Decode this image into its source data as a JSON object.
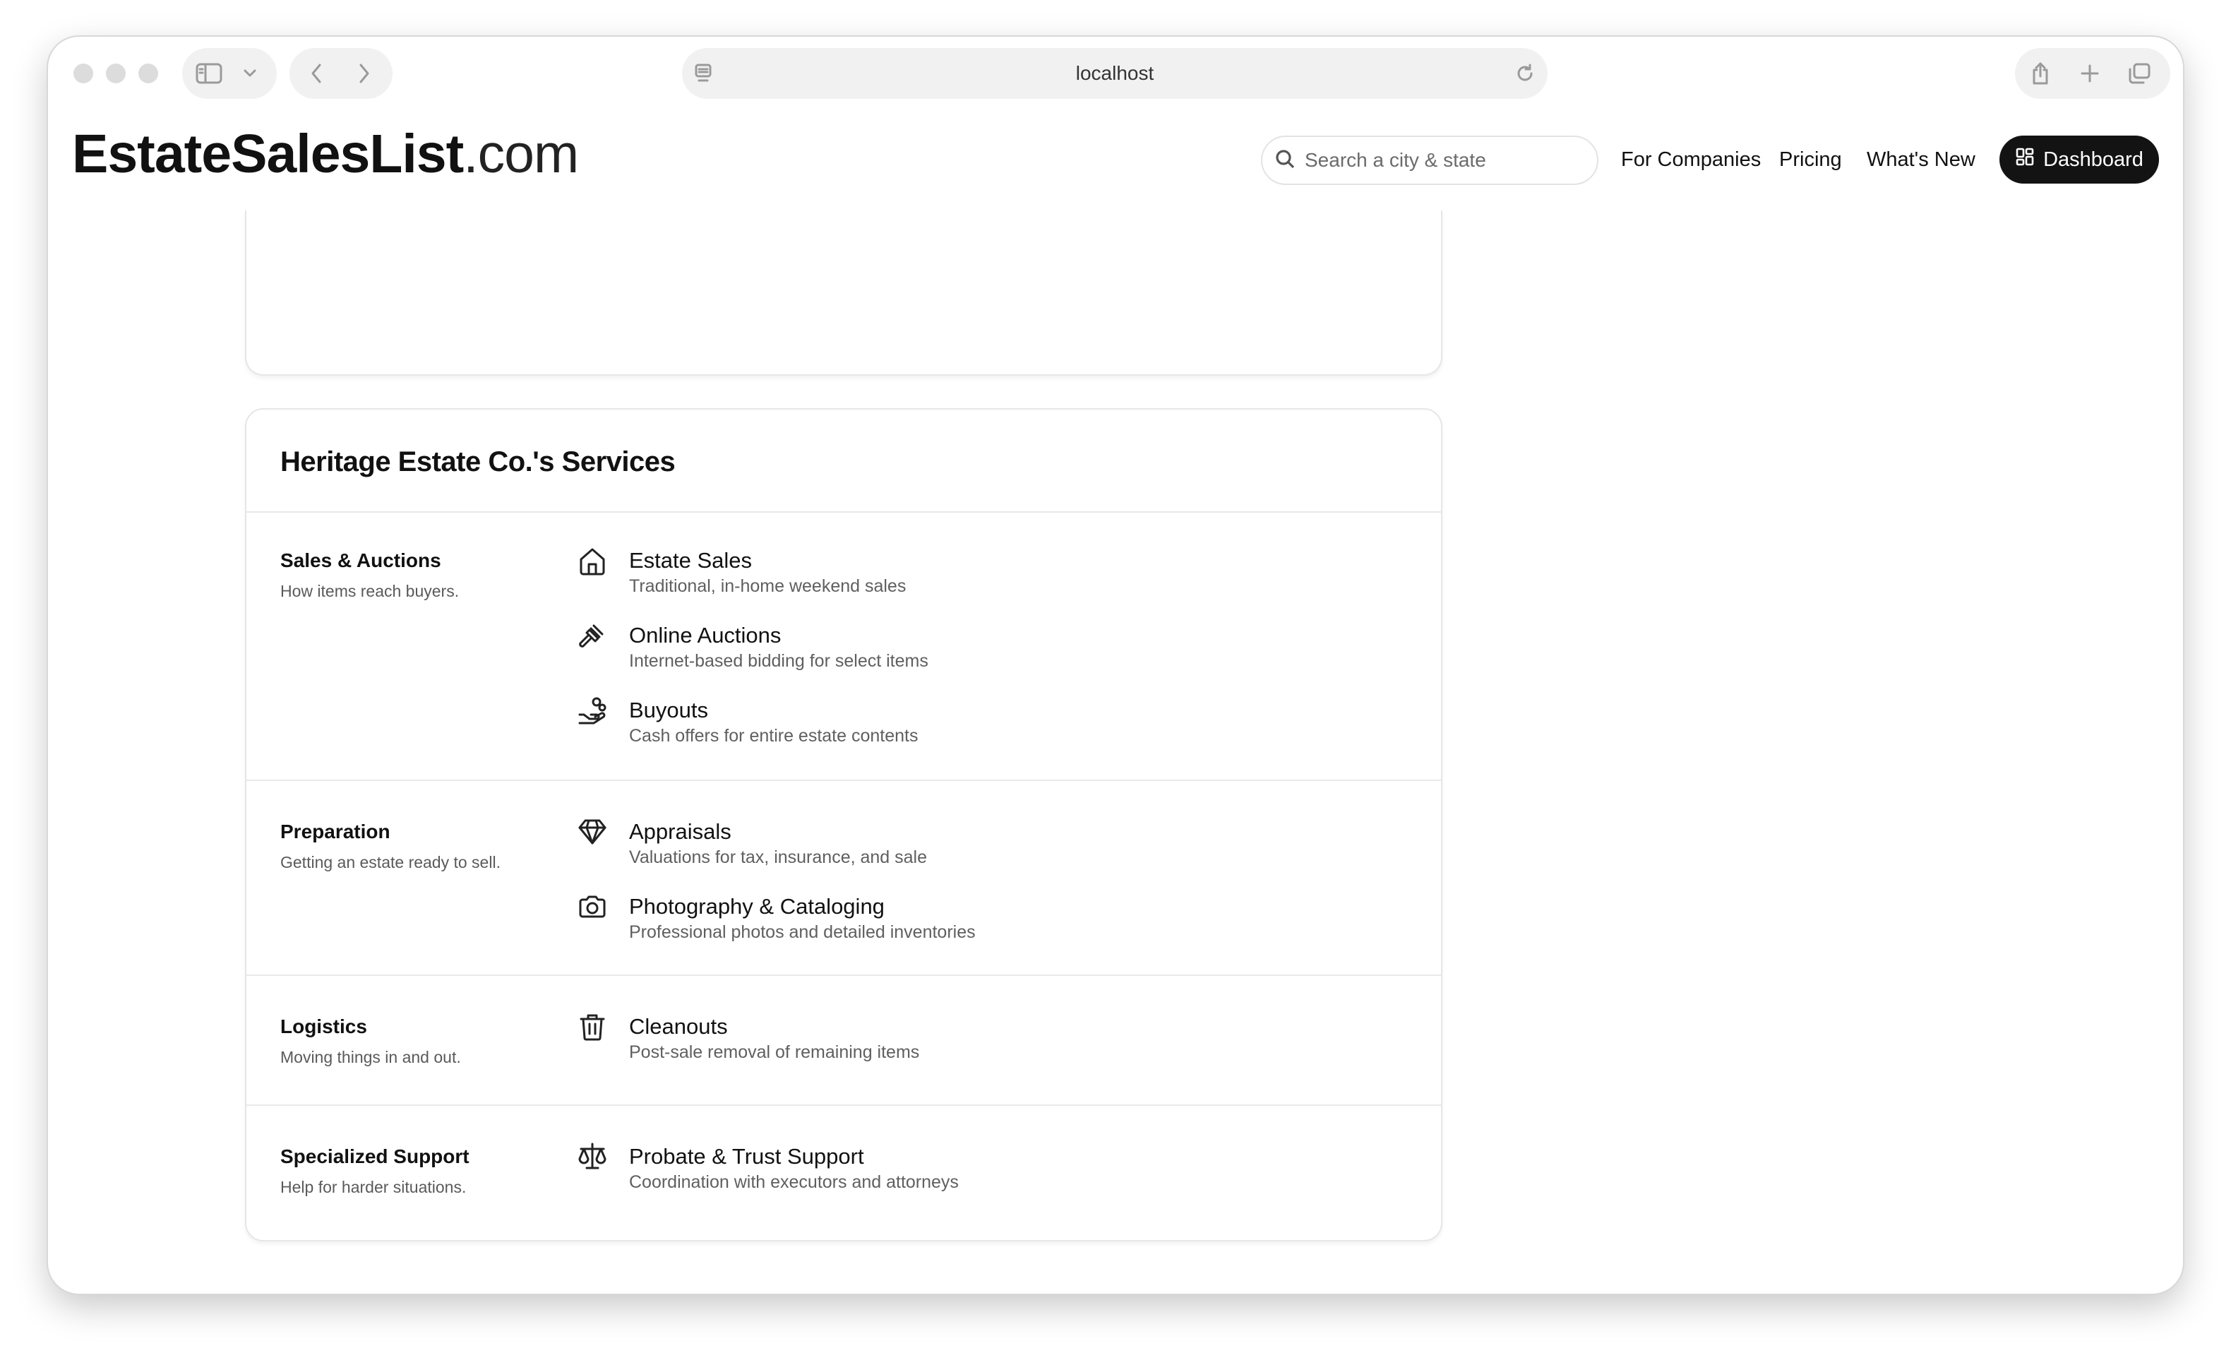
{
  "browser": {
    "url": "localhost"
  },
  "header": {
    "logo_main": "EstateSalesList",
    "logo_tld": ".com",
    "search_placeholder": "Search a city & state",
    "nav": [
      "For Companies",
      "Pricing",
      "What's New"
    ],
    "dashboard_label": "Dashboard"
  },
  "services": {
    "title": "Heritage Estate Co.'s Services",
    "groups": [
      {
        "name": "Sales & Auctions",
        "description": "How items reach buyers.",
        "items": [
          {
            "icon": "house-icon",
            "name": "Estate Sales",
            "description": "Traditional, in-home weekend sales"
          },
          {
            "icon": "gavel-icon",
            "name": "Online Auctions",
            "description": "Internet-based bidding for select items"
          },
          {
            "icon": "hand-coins-icon",
            "name": "Buyouts",
            "description": "Cash offers for entire estate contents"
          }
        ]
      },
      {
        "name": "Preparation",
        "description": "Getting an estate ready to sell.",
        "items": [
          {
            "icon": "gem-icon",
            "name": "Appraisals",
            "description": "Valuations for tax, insurance, and sale"
          },
          {
            "icon": "camera-icon",
            "name": "Photography & Cataloging",
            "description": "Professional photos and detailed inventories"
          }
        ]
      },
      {
        "name": "Logistics",
        "description": "Moving things in and out.",
        "items": [
          {
            "icon": "trash-icon",
            "name": "Cleanouts",
            "description": "Post-sale removal of remaining items"
          }
        ]
      },
      {
        "name": "Specialized Support",
        "description": "Help for harder situations.",
        "items": [
          {
            "icon": "scale-icon",
            "name": "Probate & Trust Support",
            "description": "Coordination with executors and attorneys"
          }
        ]
      }
    ]
  }
}
